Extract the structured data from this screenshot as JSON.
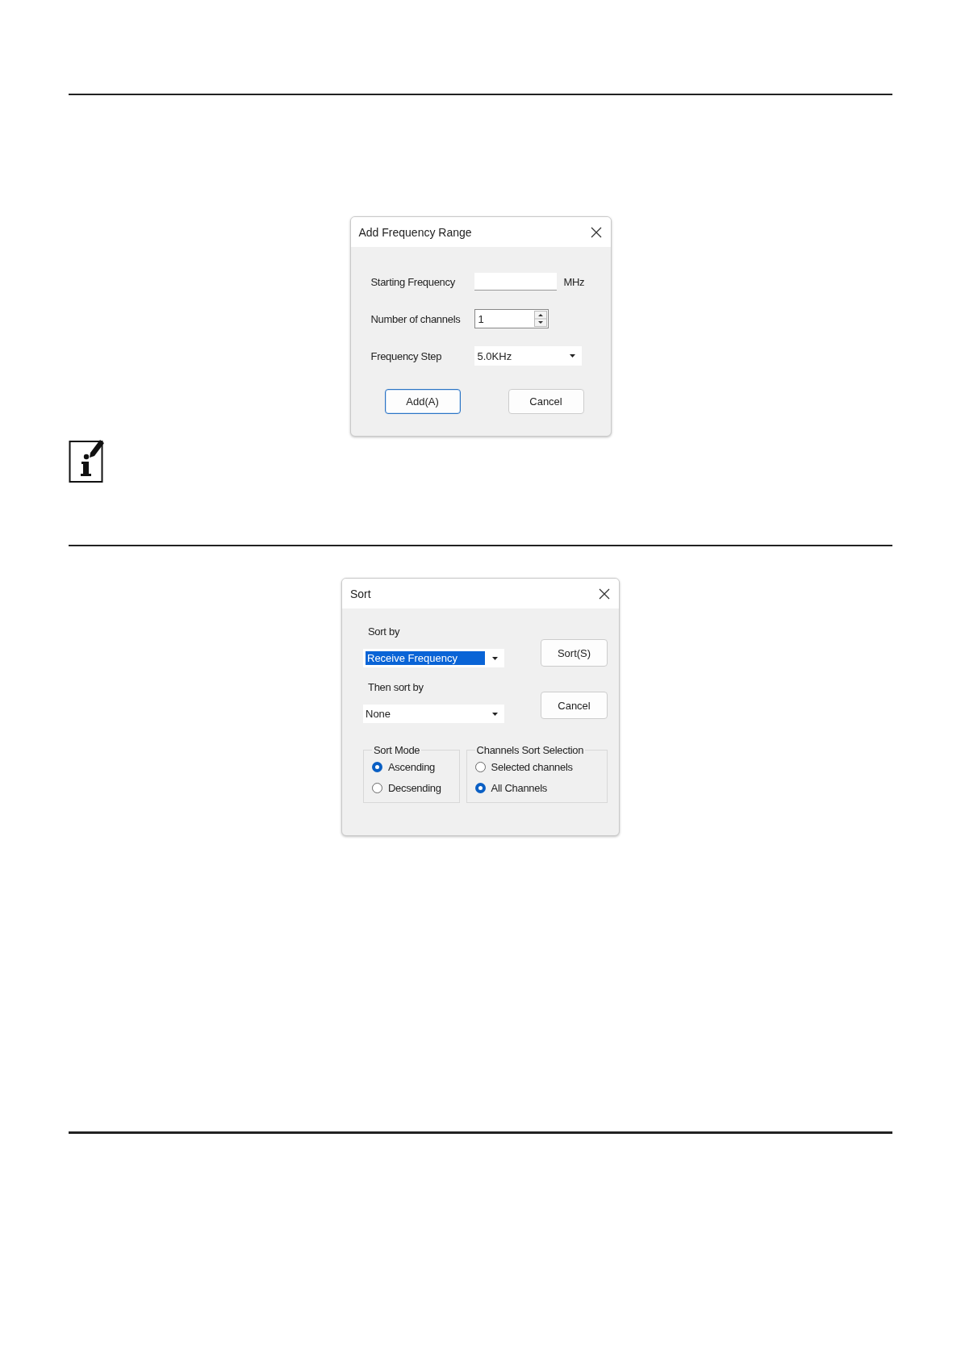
{
  "add_frequency_range": {
    "title": "Add Frequency Range",
    "starting_frequency": {
      "label": "Starting Frequency",
      "unit": "MHz"
    },
    "number_of_channels": {
      "label": "Number of channels",
      "value": "1"
    },
    "frequency_step": {
      "label": "Frequency Step",
      "value": "5.0KHz"
    },
    "buttons": [
      {
        "label": "Add(A)",
        "focused": true
      },
      {
        "label": "Cancel",
        "focused": false
      }
    ]
  },
  "sort": {
    "title": "Sort",
    "sort_by": {
      "label": "Sort by",
      "value": "Receive Frequency",
      "highlighted": true
    },
    "then_sort_by": {
      "label": "Then sort by",
      "value": "None",
      "highlighted": false
    },
    "buttons": [
      {
        "label": "Sort(S)",
        "focused": false
      },
      {
        "label": "Cancel",
        "focused": false
      }
    ],
    "groups": [
      {
        "title": "Sort Mode",
        "options": [
          {
            "label": "Ascending",
            "selected": true
          },
          {
            "label": "Decsending",
            "selected": false
          }
        ]
      },
      {
        "title": "Channels Sort Selection",
        "options": [
          {
            "label": "Selected channels",
            "selected": false
          },
          {
            "label": "All Channels",
            "selected": true
          }
        ]
      }
    ]
  }
}
